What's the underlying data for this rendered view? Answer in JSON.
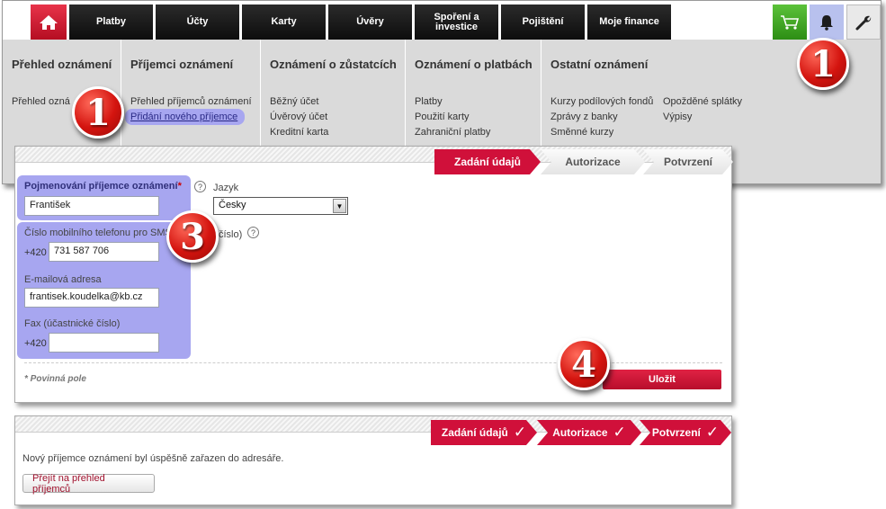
{
  "nav": {
    "tabs": [
      "Platby",
      "Účty",
      "Karty",
      "Úvěry",
      "Spoření a investice",
      "Pojištění",
      "Moje finance"
    ],
    "icons": [
      "home-icon",
      "cart-icon",
      "bell-icon",
      "wrench-icon"
    ]
  },
  "menu": {
    "col1": {
      "head": "Přehled oznámení",
      "links": [
        "Přehled ozná"
      ]
    },
    "col2": {
      "head": "Příjemci oznámení",
      "links": [
        "Přehled příjemců oznámení",
        "Přidání nového příjemce"
      ]
    },
    "col3": {
      "head": "Oznámení o zůstatcích",
      "links": [
        "Běžný účet",
        "Úvěrový účet",
        "Kreditní karta"
      ]
    },
    "col4": {
      "head": "Oznámení o platbách",
      "links": [
        "Platby",
        "Použití karty",
        "Zahraniční platby"
      ]
    },
    "col5": {
      "head": "Ostatní oznámení",
      "links": [
        "Kurzy podílových fondů",
        "Zprávy z banky",
        "Směnné kurzy",
        "Opožděné splátky",
        "Výpisy"
      ]
    }
  },
  "badges": {
    "b1": "1",
    "b1b": "1",
    "b3": "3",
    "b4": "4"
  },
  "steps": [
    "Zadání údajů",
    "Autorizace",
    "Potvrzení"
  ],
  "form": {
    "name_label": "Pojmenování příjemce oznámení",
    "name_required_mark": "*",
    "name_value": "František",
    "lang_label": "Jazyk",
    "lang_value": "Česky",
    "mobile_label": "Číslo mobilního telefonu pro SMS",
    "mobile_suffix": "číslo)",
    "mobile_prefix": "+420",
    "mobile_value": "731 587 706",
    "email_label": "E-mailová adresa",
    "email_value": "frantisek.koudelka@kb.cz",
    "fax_label": "Fax (účastnické číslo)",
    "fax_prefix": "+420",
    "fax_value": "",
    "required_note": "* Povinná pole",
    "save_label": "Uložit"
  },
  "confirm": {
    "message": "Nový příjemce oznámení byl úspěšně zařazen do adresáře.",
    "button": "Přejít na přehled příjemců",
    "check": "✓"
  }
}
